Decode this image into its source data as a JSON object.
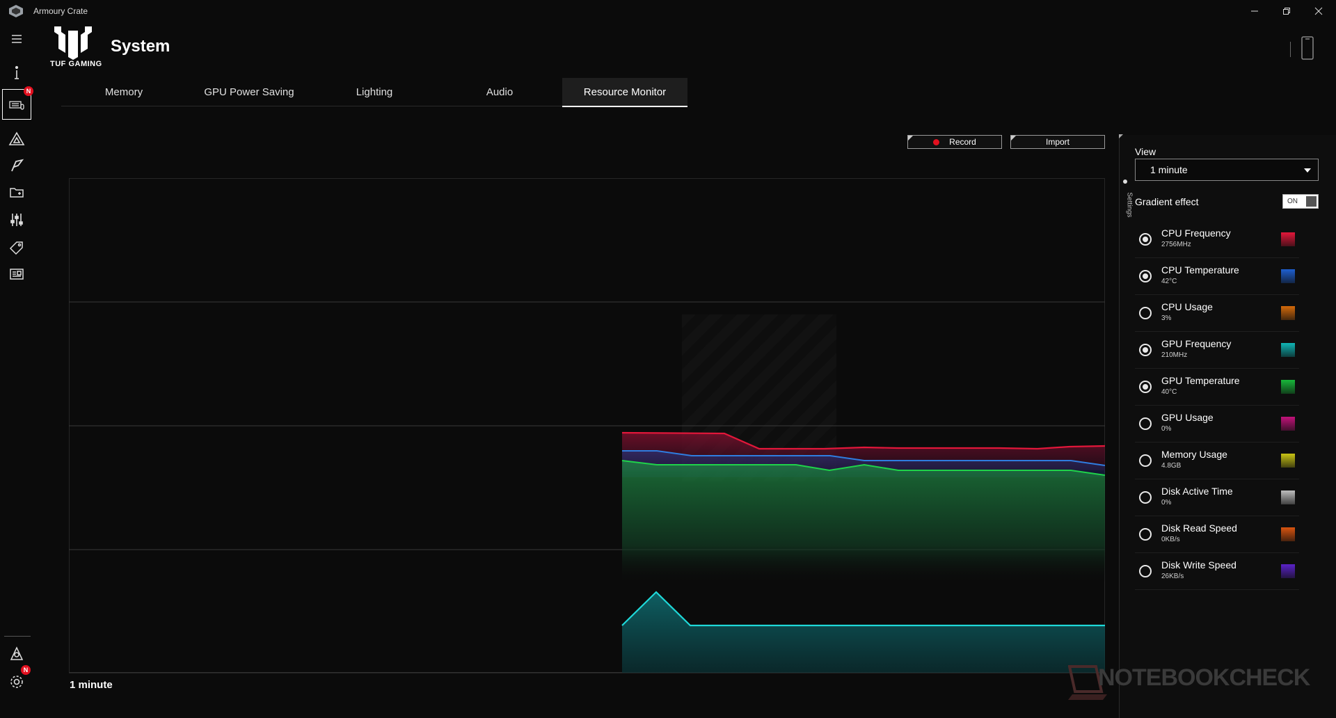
{
  "app": {
    "title": "Armoury Crate"
  },
  "header": {
    "logo_text": "TUF GAMING",
    "page_title": "System"
  },
  "tabs": [
    {
      "label": "Memory"
    },
    {
      "label": "GPU Power Saving"
    },
    {
      "label": "Lighting"
    },
    {
      "label": "Audio"
    },
    {
      "label": "Resource Monitor",
      "active": true
    }
  ],
  "toolbar": {
    "record_label": "Record",
    "import_label": "Import"
  },
  "chart": {
    "caption": "1 minute"
  },
  "settings": {
    "tab_label": "Settings",
    "view_label": "View",
    "view_value": "1 minute",
    "gradient_label": "Gradient effect",
    "gradient_state": "ON",
    "metrics": [
      {
        "name": "CPU Frequency",
        "value": "2756MHz",
        "selected": true,
        "color": "#e3173a"
      },
      {
        "name": "CPU Temperature",
        "value": "42°C",
        "selected": true,
        "color": "#1e5fd0"
      },
      {
        "name": "CPU Usage",
        "value": "3%",
        "selected": false,
        "color": "#d46a0a"
      },
      {
        "name": "GPU Frequency",
        "value": "210MHz",
        "selected": true,
        "color": "#0fb5b5"
      },
      {
        "name": "GPU Temperature",
        "value": "40°C",
        "selected": true,
        "color": "#18b83a"
      },
      {
        "name": "GPU Usage",
        "value": "0%",
        "selected": false,
        "color": "#c2127a"
      },
      {
        "name": "Memory Usage",
        "value": "4.8GB",
        "selected": false,
        "color": "#c9c414"
      },
      {
        "name": "Disk Active Time",
        "value": "0%",
        "selected": false,
        "color": "#bdbdbd"
      },
      {
        "name": "Disk Read Speed",
        "value": "0KB/s",
        "selected": false,
        "color": "#d9540f"
      },
      {
        "name": "Disk Write Speed",
        "value": "26KB/s",
        "selected": false,
        "color": "#5a22c8"
      }
    ]
  },
  "watermark": "NOTEBOOKCHECK"
}
